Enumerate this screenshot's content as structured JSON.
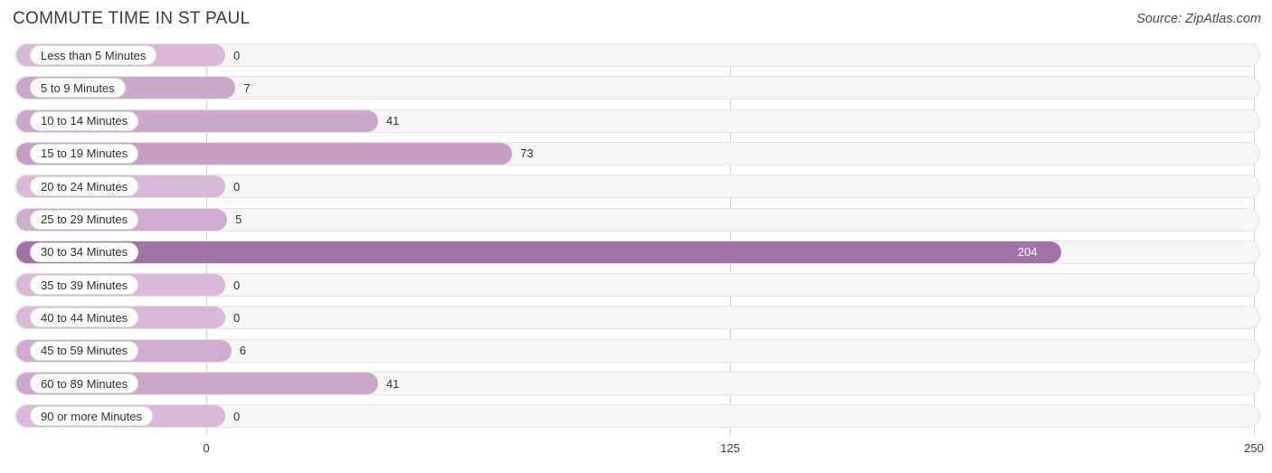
{
  "header": {
    "title": "COMMUTE TIME IN ST PAUL",
    "source": "Source: ZipAtlas.com"
  },
  "colors": {
    "bar_light": "#d9b8d8",
    "bar_mid": "#cca8cb",
    "bar_strong": "#c49ec4",
    "bar_dark": "#a273a8",
    "track_bg": "#f6f6f6",
    "track_border": "#e3e3e3",
    "gridline": "#d2d2d2",
    "label_text": "#2f2f2f",
    "title_text": "#3a3a3a"
  },
  "axis": {
    "ticks": [
      "0",
      "125",
      "250"
    ],
    "min": 0,
    "max": 250
  },
  "chart_data": {
    "type": "bar",
    "orientation": "horizontal",
    "title": "COMMUTE TIME IN ST PAUL",
    "xlabel": "",
    "ylabel": "",
    "xlim": [
      0,
      250
    ],
    "grid": true,
    "legend": "none",
    "source": "Source: ZipAtlas.com",
    "categories": [
      "Less than 5 Minutes",
      "5 to 9 Minutes",
      "10 to 14 Minutes",
      "15 to 19 Minutes",
      "20 to 24 Minutes",
      "25 to 29 Minutes",
      "30 to 34 Minutes",
      "35 to 39 Minutes",
      "40 to 44 Minutes",
      "45 to 59 Minutes",
      "60 to 89 Minutes",
      "90 or more Minutes"
    ],
    "values": [
      0,
      7,
      41,
      73,
      0,
      5,
      204,
      0,
      0,
      6,
      41,
      0
    ],
    "tick_labels": [
      "0",
      "125",
      "250"
    ]
  },
  "bars": [
    {
      "label": "Less than 5 Minutes",
      "value": 0,
      "value_text": "0",
      "color": "#d9b8d8",
      "inside": false
    },
    {
      "label": "5 to 9 Minutes",
      "value": 7,
      "value_text": "7",
      "color": "#cca8cb",
      "inside": false
    },
    {
      "label": "10 to 14 Minutes",
      "value": 41,
      "value_text": "41",
      "color": "#cca8cb",
      "inside": false
    },
    {
      "label": "15 to 19 Minutes",
      "value": 73,
      "value_text": "73",
      "color": "#c49ec4",
      "inside": false
    },
    {
      "label": "20 to 24 Minutes",
      "value": 0,
      "value_text": "0",
      "color": "#d9b8d8",
      "inside": false
    },
    {
      "label": "25 to 29 Minutes",
      "value": 5,
      "value_text": "5",
      "color": "#cfaccd",
      "inside": false
    },
    {
      "label": "30 to 34 Minutes",
      "value": 204,
      "value_text": "204",
      "color": "#a273a8",
      "inside": true
    },
    {
      "label": "35 to 39 Minutes",
      "value": 0,
      "value_text": "0",
      "color": "#d9b8d8",
      "inside": false
    },
    {
      "label": "40 to 44 Minutes",
      "value": 0,
      "value_text": "0",
      "color": "#d9b8d8",
      "inside": false
    },
    {
      "label": "45 to 59 Minutes",
      "value": 6,
      "value_text": "6",
      "color": "#cfaccd",
      "inside": false
    },
    {
      "label": "60 to 89 Minutes",
      "value": 41,
      "value_text": "41",
      "color": "#cca8cb",
      "inside": false
    },
    {
      "label": "90 or more Minutes",
      "value": 0,
      "value_text": "0",
      "color": "#d9b8d8",
      "inside": false
    }
  ]
}
